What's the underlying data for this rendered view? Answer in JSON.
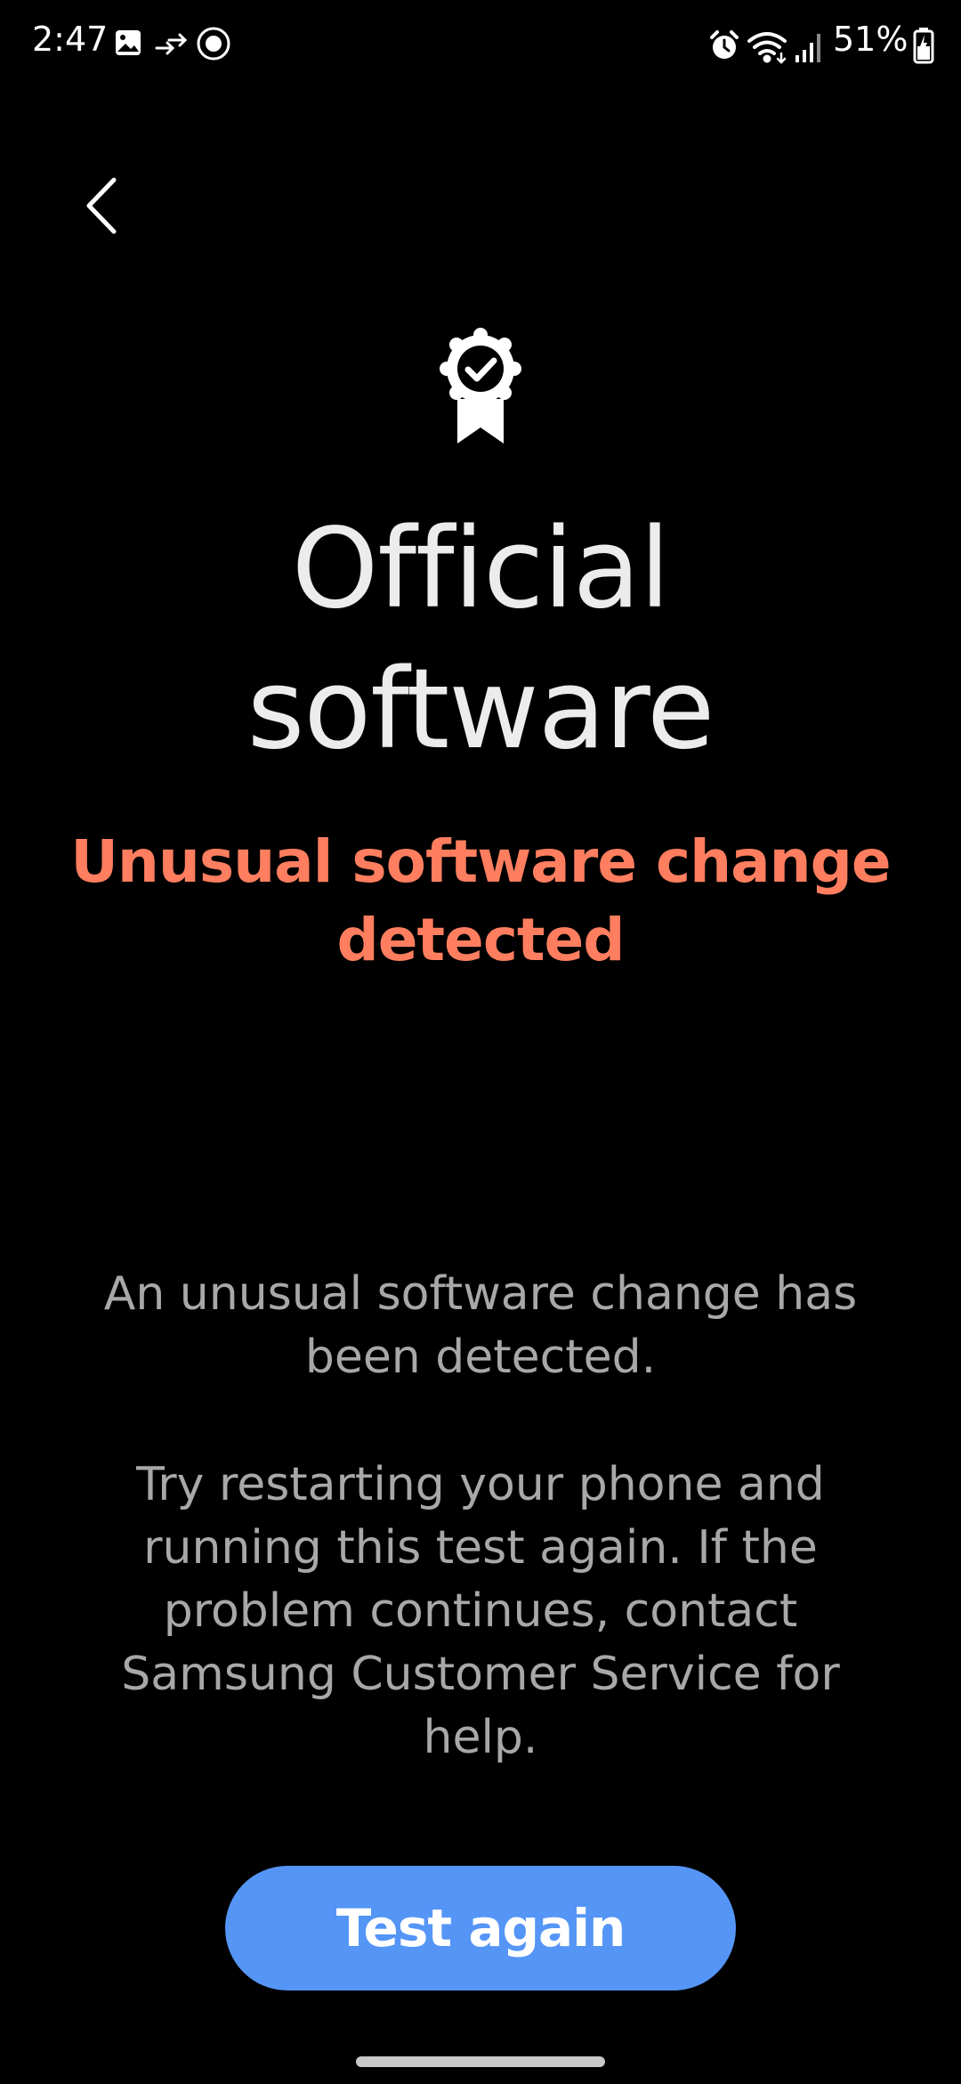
{
  "status_bar": {
    "time": "2:47",
    "battery": "51%",
    "left_icons": [
      "gallery-icon",
      "data-transfer-icon",
      "circle-record-icon"
    ],
    "right_icons": [
      "alarm-icon",
      "wifi-icon",
      "signal-icon",
      "battery-charging-icon"
    ]
  },
  "nav": {
    "back_icon": "chevron-left-icon"
  },
  "hero": {
    "icon": "award-badge-check-icon",
    "title_line1": "Official",
    "title_line2": "software",
    "warning_line1": "Unusual software change",
    "warning_line2": "detected"
  },
  "body": {
    "paragraph1_lines": [
      "An unusual software change has",
      "been detected."
    ],
    "paragraph2_lines": [
      "Try restarting your phone and",
      "running this test again. If the",
      "problem continues, contact",
      "Samsung Customer Service for",
      "help."
    ]
  },
  "actions": {
    "test_again_label": "Test again"
  },
  "colors": {
    "background": "#000000",
    "title": "#ececec",
    "warning": "#ff7e5f",
    "body_text": "#a8a8a8",
    "button": "#5595f6",
    "button_text": "#ffffff"
  }
}
